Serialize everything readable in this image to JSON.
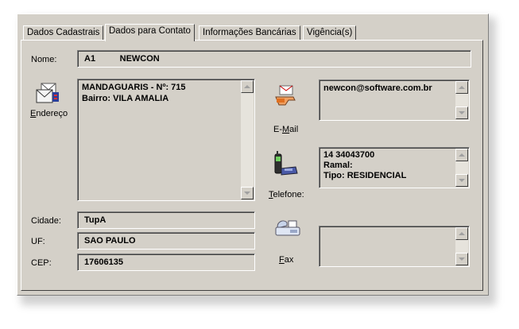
{
  "tabs": [
    {
      "label": "Dados Cadastrais"
    },
    {
      "label": "Dados para Contato"
    },
    {
      "label": "Informações Bancárias"
    },
    {
      "label": "Vigência(s)"
    }
  ],
  "active_tab": "Dados para Contato",
  "nome": {
    "label": "Nome:",
    "value": "A1          NEWCON"
  },
  "endereco": {
    "label_first": "E",
    "label_rest": "ndereço",
    "lines": [
      "MANDAGUARIS - Nº: 715",
      "Bairro: VILA AMALIA"
    ]
  },
  "cidade": {
    "label": "Cidade:",
    "value": "TupA"
  },
  "uf": {
    "label": "UF:",
    "value": "SAO PAULO"
  },
  "cep": {
    "label": "CEP:",
    "value": "17606135"
  },
  "email": {
    "label_first": "E-",
    "label_u": "M",
    "label_rest": "ail",
    "lines": [
      "newcon@software.com.br"
    ]
  },
  "telefone": {
    "label_u": "T",
    "label_rest": "elefone:",
    "lines": [
      "14 34043700",
      "Ramal:",
      "Tipo: RESIDENCIAL"
    ]
  },
  "fax": {
    "label_u": "F",
    "label_rest": "ax",
    "lines": []
  },
  "icons": {
    "endereco": "address-envelopes-icon",
    "email": "email-hand-icon",
    "telefone": "cellphone-icon",
    "fax": "fax-machine-icon"
  }
}
